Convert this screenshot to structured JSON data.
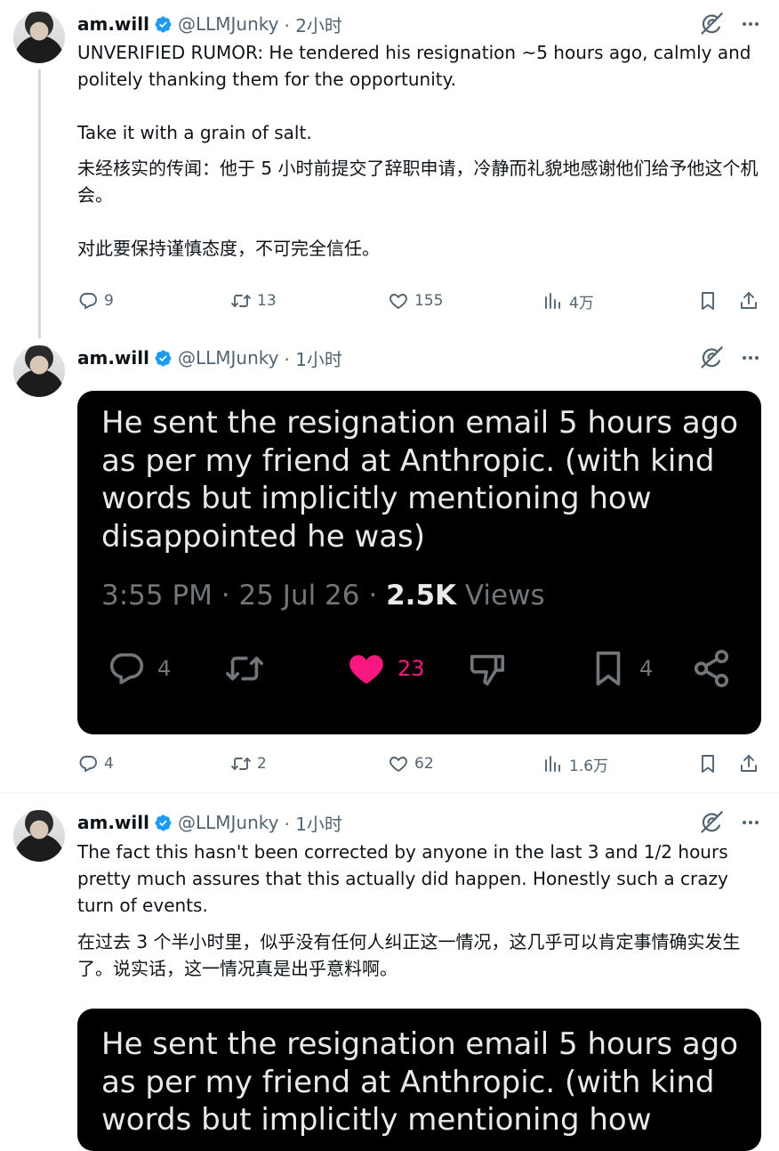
{
  "colors": {
    "verified": "#1d9bf0",
    "like_active": "#f91880",
    "muted": "#536471",
    "card_bg": "#000000"
  },
  "tweets": [
    {
      "name": "am.will",
      "handle": "@LLMJunky",
      "time": "· 2小时",
      "text_en": "UNVERIFIED RUMOR: He tendered his resignation ~5 hours ago, calmly and politely thanking them for the opportunity.\n\nTake it with a grain of salt.",
      "text_zh": "未经核实的传闻：他于 5 小时前提交了辞职申请，冷静而礼貌地感谢他们给予他这个机会。\n\n对此要保持谨慎态度，不可完全信任。",
      "stats": {
        "replies": "9",
        "reposts": "13",
        "likes": "155",
        "views": "4万"
      }
    },
    {
      "name": "am.will",
      "handle": "@LLMJunky",
      "time": "· 1小时",
      "card": {
        "text": "He sent the resignation email 5 hours ago as per my friend at Anthropic. (with kind words but implicitly mentioning how disappointed he was)",
        "time": "3:55 PM",
        "sep1": "·",
        "date": "25 Jul 26",
        "sep2": "·",
        "views_count": "2.5K",
        "views_label": "Views",
        "replies": "4",
        "likes": "23",
        "bookmarks": "4"
      },
      "stats": {
        "replies": "4",
        "reposts": "2",
        "likes": "62",
        "views": "1.6万"
      }
    },
    {
      "name": "am.will",
      "handle": "@LLMJunky",
      "time": "· 1小时",
      "text_en": "The fact this hasn't been corrected by anyone in the last 3 and 1/2 hours pretty much assures that this actually did happen. Honestly such a crazy turn of events.",
      "text_zh": "在过去 3 个半小时里，似乎没有任何人纠正这一情况，这几乎可以肯定事情确实发生了。说实话，这一情况真是出乎意料啊。",
      "card": {
        "text": "He sent the resignation email 5 hours ago as per my friend at Anthropic. (with kind words but implicitly mentioning how"
      }
    }
  ],
  "icons": {
    "grok": "grok-icon",
    "more": "more-icon",
    "verified": "verified-badge-icon",
    "reply": "reply-icon",
    "repost": "repost-icon",
    "like": "like-icon",
    "views": "views-icon",
    "bookmark": "bookmark-icon",
    "share": "share-icon",
    "dislike": "dislike-icon"
  }
}
